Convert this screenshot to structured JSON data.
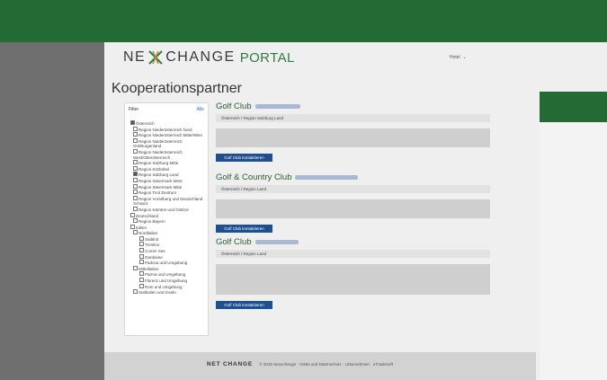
{
  "header": {
    "logo_left": "NE",
    "logo_right": "CHANGE",
    "logo_portal": "PORTAL",
    "user_menu": "Hotel ⁠ ⌄"
  },
  "page_title": "Kooperationspartner",
  "filter": {
    "label": "Filter",
    "all_link": "Alle",
    "items": [
      {
        "label": "Österreich",
        "level": 1,
        "checked": true
      },
      {
        "label": "Region Niederösterreich Nord",
        "level": 2
      },
      {
        "label": "Region Niederösterreich Mitte/Wien",
        "level": 2
      },
      {
        "label": "Region Niederösterreich Ost/Burgenland",
        "level": 2
      },
      {
        "label": "Region Niederösterreich West/Oberösterreich",
        "level": 2
      },
      {
        "label": "Region Salzburg Mitte",
        "level": 2
      },
      {
        "label": "Region Kitzbühel",
        "level": 2
      },
      {
        "label": "Region Salzburg Land",
        "level": 2,
        "checked": true
      },
      {
        "label": "Region Steiermark West",
        "level": 2
      },
      {
        "label": "Region Steiermark Mitte",
        "level": 2
      },
      {
        "label": "Region Tirol Zentrum",
        "level": 2
      },
      {
        "label": "Region Vorarlberg und Deutschland Schweiz",
        "level": 2
      },
      {
        "label": "Region Kärnten und Osttirol",
        "level": 2
      },
      {
        "label": "Deutschland",
        "level": 1
      },
      {
        "label": "Region Bayern",
        "level": 2
      },
      {
        "label": "Italien",
        "level": 1
      },
      {
        "label": "Norditalien",
        "level": 2
      },
      {
        "label": "Südtirol",
        "level": 3
      },
      {
        "label": "Trentino",
        "level": 3
      },
      {
        "label": "Comer See",
        "level": 3
      },
      {
        "label": "Gardasee",
        "level": 3
      },
      {
        "label": "Padova und Umgebung",
        "level": 3
      },
      {
        "label": "Mittelitalien",
        "level": 2
      },
      {
        "label": "Parma und Umgebung",
        "level": 3
      },
      {
        "label": "Florenz und Umgebung",
        "level": 3
      },
      {
        "label": "Rom und Umgebung",
        "level": 3
      },
      {
        "label": "Süditalien und Inseln",
        "level": 2
      }
    ]
  },
  "clubs": [
    {
      "title": "Golf Club",
      "region": "Österreich / Region Salzburg Land",
      "button": "Golf Club kontaktieren"
    },
    {
      "title": "Golf & Country Club",
      "region": "Österreich / Region Land",
      "button": "Golf Club kontaktieren"
    },
    {
      "title": "Golf Club",
      "region": "Österreich / Region Land",
      "button": "Golf Club kontaktieren"
    }
  ],
  "footer": {
    "brand": "NET CHANGE",
    "text": "© 2015 Nexxchange · AGBs und Datenschutz · Unternehmen · eTradeSoft"
  },
  "colors": {
    "header_green": "#236a34",
    "button_blue": "#1e4f8e",
    "title_green": "#2a5c34"
  }
}
